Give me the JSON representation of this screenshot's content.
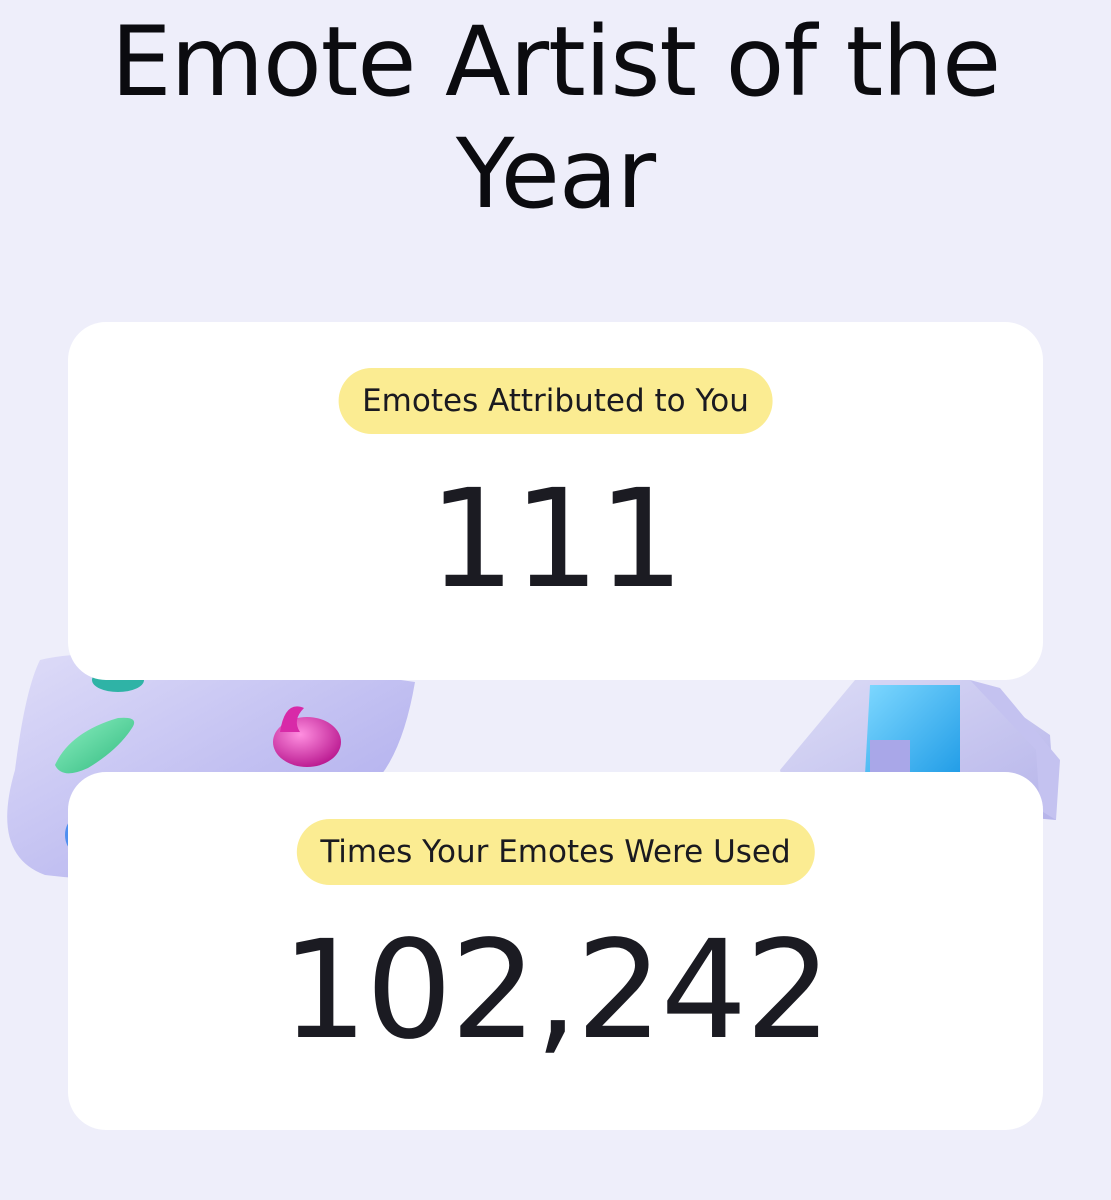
{
  "page": {
    "title": "Emote Artist of the Year"
  },
  "stats": [
    {
      "label": "Emotes Attributed to You",
      "value": "111"
    },
    {
      "label": "Times Your Emotes Were Used",
      "value": "102,242"
    }
  ],
  "decorations": {
    "left": "paint-palette-illustration",
    "right": "blue-frame-illustration"
  },
  "colors": {
    "background": "#eeeefa",
    "card": "#ffffff",
    "label_pill": "#fbec92",
    "text": "#1b1b22",
    "palette": "#c8c6f2",
    "paint_green": "#4fd09a",
    "paint_pink": "#e03cb8",
    "paint_teal": "#2fb3a6",
    "frame_blue": "#3fb8f2"
  }
}
